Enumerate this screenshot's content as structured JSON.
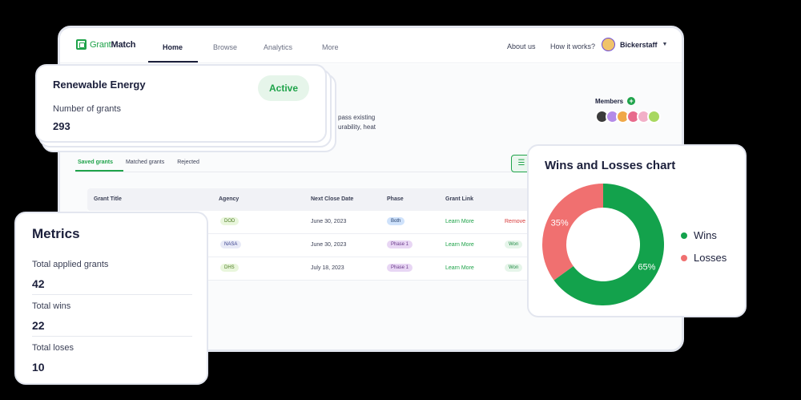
{
  "colors": {
    "brand": "#1fa34a",
    "wins": "#13a24c",
    "losses": "#f07070",
    "remove": "#d93b3b"
  },
  "nav": {
    "logo_grant": "Grant",
    "logo_match": "Match",
    "tabs": [
      "Home",
      "Browse",
      "Analytics",
      "More"
    ],
    "about": "About us",
    "how": "How it works?",
    "user": "Bickerstaff"
  },
  "description": {
    "line1": "pass existing",
    "line2": "urability, heat"
  },
  "members": {
    "label": "Members"
  },
  "sub_tabs": [
    "Saved grants",
    "Matched grants",
    "Rejected"
  ],
  "table": {
    "columns": [
      "Grant Title",
      "Agency",
      "Next Close Date",
      "Phase",
      "Grant Link"
    ],
    "rows": [
      {
        "agency": "DOD",
        "date": "June 30, 2023",
        "phase": "Both",
        "link": "Learn More",
        "action": "Remove"
      },
      {
        "agency": "NASA",
        "date": "June 30, 2023",
        "phase": "Phase 1",
        "link": "Learn More",
        "action": "Won"
      },
      {
        "agency": "DHS",
        "date": "July 18, 2023",
        "phase": "Phase 1",
        "link": "Learn More",
        "action": "Won"
      }
    ]
  },
  "energy_card": {
    "title": "Renewable Energy",
    "status": "Active",
    "grants_label": "Number of grants",
    "grants_value": "293"
  },
  "metrics": {
    "title": "Metrics",
    "items": [
      {
        "label": "Total applied grants",
        "value": "42"
      },
      {
        "label": "Total wins",
        "value": "22"
      },
      {
        "label": "Total loses",
        "value": "10"
      }
    ]
  },
  "chart_data": {
    "type": "pie",
    "title": "Wins and Losses chart",
    "categories": [
      "Wins",
      "Losses"
    ],
    "values": [
      65,
      35
    ],
    "labels": [
      "65%",
      "35%"
    ],
    "donut": true,
    "legend": "right"
  }
}
